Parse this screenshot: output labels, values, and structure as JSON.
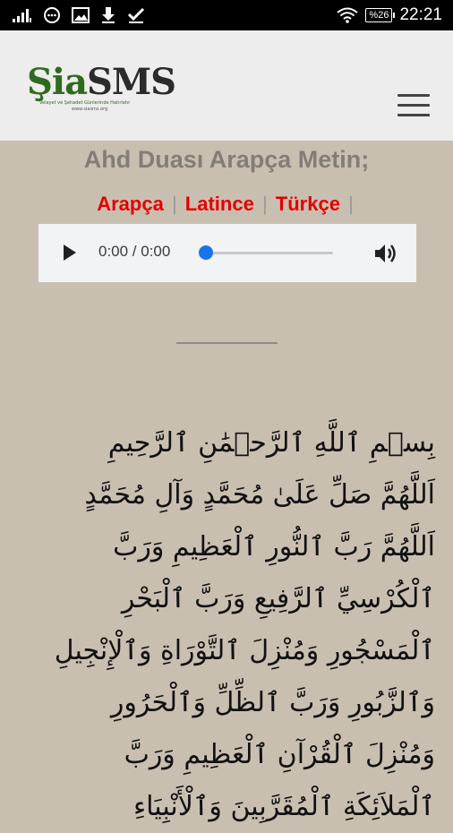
{
  "status_bar": {
    "time": "22:21",
    "battery": "%26",
    "icons": [
      "signal-icon",
      "chat-icon",
      "image-icon",
      "download-icon",
      "check-icon",
      "wifi-icon",
      "battery-icon"
    ]
  },
  "header": {
    "logo_sia": "Şia",
    "logo_sms": "SMS",
    "logo_tagline": "Velayet ve Şehadet Günlerinde Hatırlatır",
    "logo_url": "www.siasms.org",
    "menu_icon": "hamburger-menu-icon"
  },
  "main": {
    "title": "Ahd Duası Arapça Metin;",
    "lang_links": [
      "Arapça",
      "Latince",
      "Türkçe"
    ],
    "separator": "|",
    "audio": {
      "time": "0:00 / 0:00",
      "progress": 0
    },
    "arabic_lines": [
      "بِسۡمِ ٱللَّهِ ٱلرَّحۡمَٰنِ ٱلرَّحِيمِ",
      "اَللَّهُمَّ صَلِّ عَلَىٰ مُحَمَّدٍ وَآلِ مُحَمَّدٍ",
      "اَللَّهُمَّ رَبَّ ٱلنُّورِ ٱلْعَظِيمِ وَرَبَّ",
      "ٱلْكُرْسِيِّ ٱلرَّفِيعِ وَرَبَّ ٱلْبَحْرِ",
      "ٱلْمَسْجُورِ وَمُنْزِلَ ٱلتَّوْرَاةِ وَٱلْإِنْجِيلِ",
      "وَٱلزَّبُورِ وَرَبَّ ٱلظِّلِّ وَٱلْحَرُورِ",
      "وَمُنْزِلَ ٱلْقُرْآنِ ٱلْعَظِيمِ وَرَبَّ",
      "ٱلْمَلاَئِكَةِ ٱلْمُقَرَّبِينَ وَٱلْأَنْبِيَاءِ"
    ]
  },
  "colors": {
    "background": "#c9bfb1",
    "header": "#ededed",
    "link": "#e40000",
    "title": "#837d77",
    "seek": "#1a73e8"
  }
}
